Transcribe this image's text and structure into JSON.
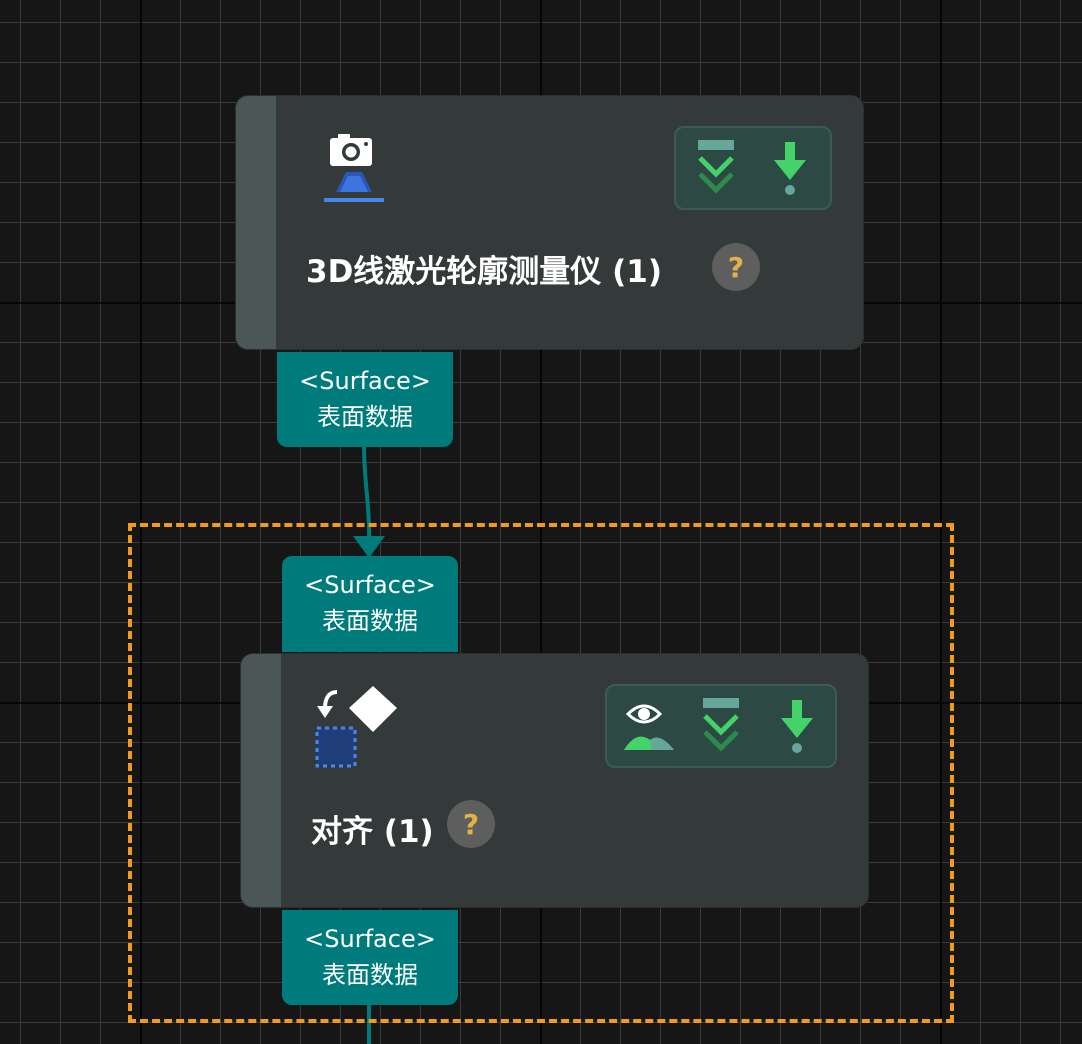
{
  "colors": {
    "canvas_bg": "#161616",
    "node_bg": "#343a3a",
    "port_bg": "#007b7b",
    "selection_border": "#f39a1e",
    "accent_green": "#43d36a",
    "help_icon": "#e0b348"
  },
  "nodes": [
    {
      "title": "3D线激光轮廓测量仪 (1)",
      "icon": "laser-profiler-camera-icon",
      "help_label": "?",
      "toolbar": [
        "steps-collapse-icon",
        "download-arrow-icon"
      ],
      "output_port": {
        "type": "<Surface>",
        "label": "表面数据"
      }
    },
    {
      "title": "对齐 (1)",
      "icon": "align-transform-icon",
      "help_label": "?",
      "selected": true,
      "toolbar": [
        "visualize-eye-icon",
        "steps-collapse-icon",
        "download-arrow-icon"
      ],
      "input_port": {
        "type": "<Surface>",
        "label": "表面数据"
      },
      "output_port": {
        "type": "<Surface>",
        "label": "表面数据"
      }
    }
  ]
}
